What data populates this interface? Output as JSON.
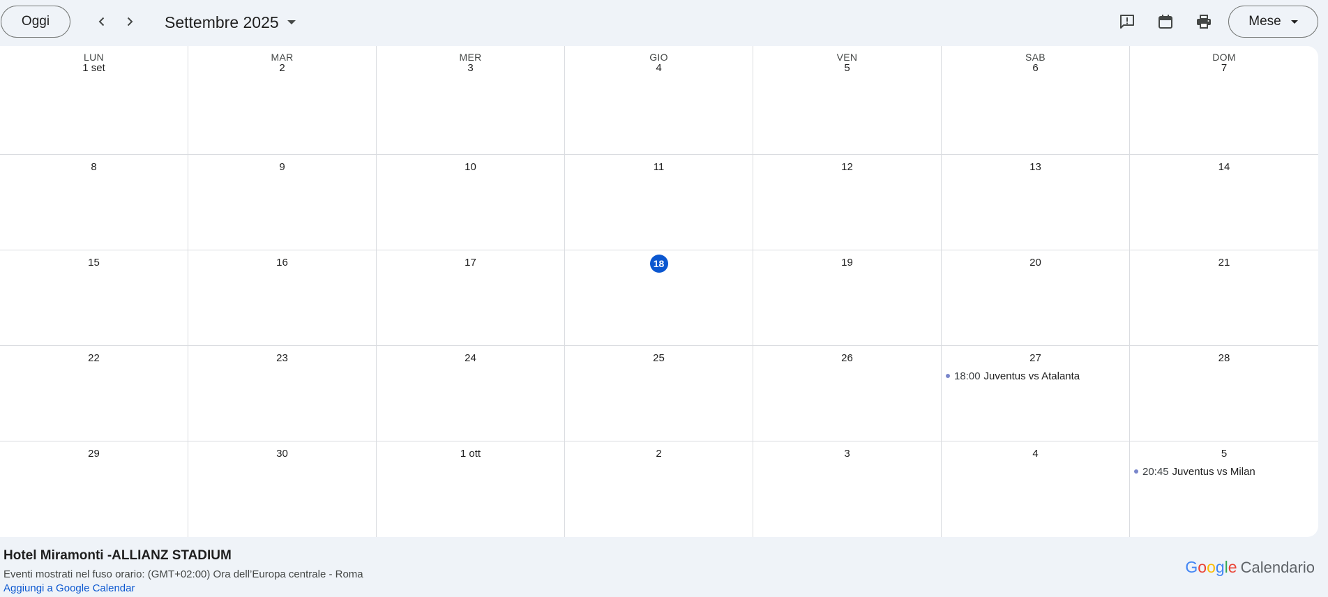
{
  "toolbar": {
    "today_label": "Oggi",
    "month_label": "Settembre 2025",
    "view_label": "Mese",
    "icons": {
      "prev": "chevron-left-icon",
      "next": "chevron-right-icon",
      "feedback": "feedback-icon",
      "calendar": "calendar-icon",
      "print": "print-icon"
    }
  },
  "calendar": {
    "weekdays": [
      "LUN",
      "MAR",
      "MER",
      "GIO",
      "VEN",
      "SAB",
      "DOM"
    ],
    "weeks": [
      [
        "1 set",
        "2",
        "3",
        "4",
        "5",
        "6",
        "7"
      ],
      [
        "8",
        "9",
        "10",
        "11",
        "12",
        "13",
        "14"
      ],
      [
        "15",
        "16",
        "17",
        "18",
        "19",
        "20",
        "21"
      ],
      [
        "22",
        "23",
        "24",
        "25",
        "26",
        "27",
        "28"
      ],
      [
        "29",
        "30",
        "1 ott",
        "2",
        "3",
        "4",
        "5"
      ]
    ],
    "today": "18",
    "events": [
      {
        "week": 3,
        "day": 5,
        "time": "18:00",
        "title": "Juventus vs Atalanta"
      },
      {
        "week": 4,
        "day": 6,
        "time": "20:45",
        "title": "Juventus vs Milan"
      }
    ],
    "colors": {
      "today": "#0b57d0",
      "event_dot": "#7986cb",
      "gridline": "#dadce0"
    }
  },
  "footer": {
    "calendar_name": "Hotel Miramonti -ALLIANZ STADIUM",
    "timezone_note": "Eventi mostrati nel fuso orario: (GMT+02:00) Ora dell’Europa centrale - Roma",
    "add_link": "Aggiungi a Google Calendar",
    "brand_google": "Google",
    "brand_product": "Calendario"
  }
}
